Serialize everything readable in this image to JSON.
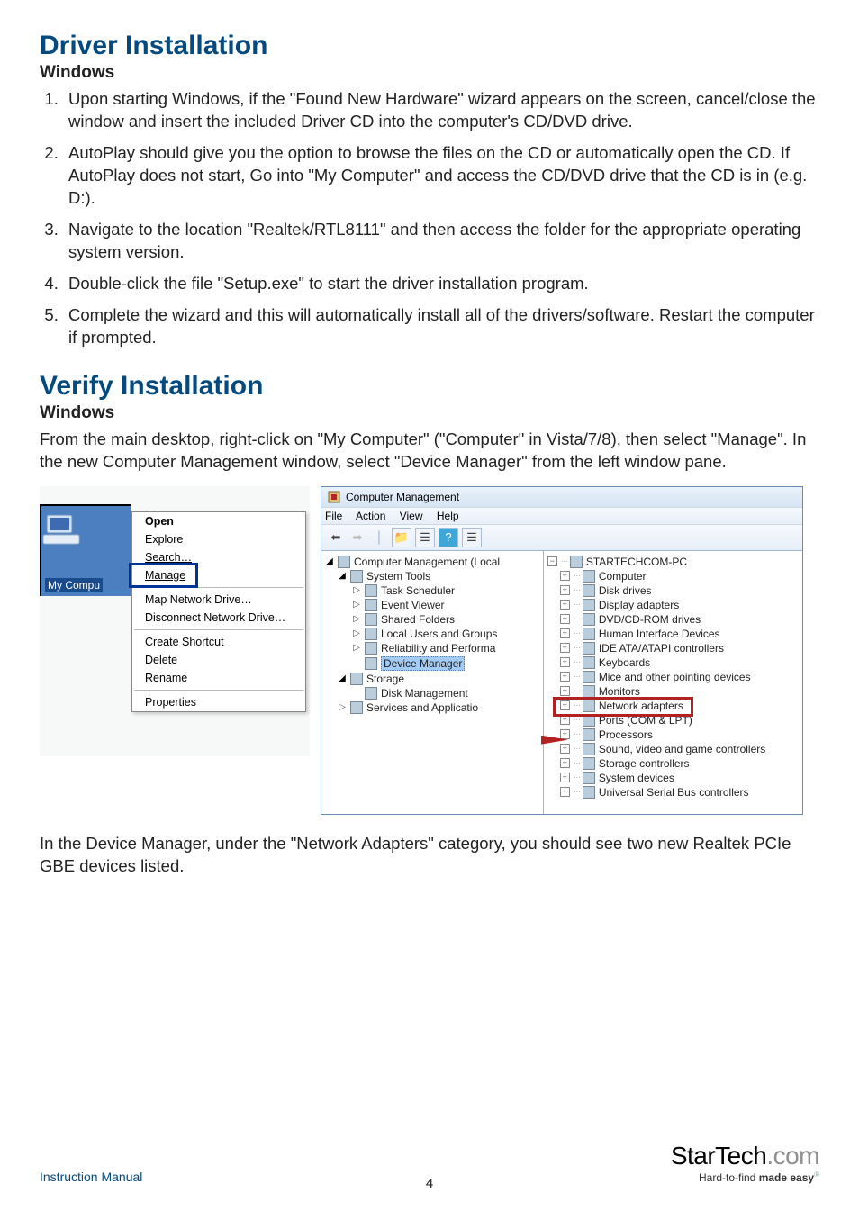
{
  "headings": {
    "h1a": "Driver Installation",
    "h2a": "Windows",
    "h1b": "Verify Installation",
    "h2b": "Windows"
  },
  "driver_steps": [
    "Upon starting Windows, if the \"Found New Hardware\" wizard appears on the screen, cancel/close the window and insert the included Driver CD into the computer's CD/DVD drive.",
    "AutoPlay should give you the option to browse the files on the CD or automatically open the CD.  If AutoPlay does not start, Go into \"My Computer\" and access the CD/DVD drive that the CD is in (e.g. D:).",
    "Navigate to the location \"Realtek/RTL8111\" and then access the folder for the appropriate operating system version.",
    "Double-click the file \"Setup.exe\" to start the driver installation program.",
    "Complete the wizard and this will automatically install all of the drivers/software.  Restart the computer if prompted."
  ],
  "verify_intro": "From the main desktop, right-click on \"My Computer\" (\"Computer\" in Vista/7/8), then select \"Manage\". In the new Computer Management window, select \"Device Manager\" from the left window pane.",
  "verify_outro": "In the Device Manager, under the \"Network Adapters\" category, you should see two new Realtek PCIe GBE devices listed.",
  "context_menu": {
    "desktop_label": "My Compu",
    "items_a": [
      "Open",
      "Explore",
      "Search…",
      "Manage"
    ],
    "items_b": [
      "Map Network Drive…",
      "Disconnect Network Drive…"
    ],
    "items_c": [
      "Create Shortcut",
      "Delete",
      "Rename"
    ],
    "items_d": [
      "Properties"
    ]
  },
  "cm_window": {
    "title": "Computer Management",
    "menus": [
      "File",
      "Action",
      "View",
      "Help"
    ],
    "left_pane": [
      {
        "text": "Computer Management (Local",
        "indent": 0,
        "exp": "open",
        "icon": "tool"
      },
      {
        "text": "System Tools",
        "indent": 1,
        "exp": "open",
        "icon": "tools"
      },
      {
        "text": "Task Scheduler",
        "indent": 2,
        "exp": "closed",
        "icon": "clock"
      },
      {
        "text": "Event Viewer",
        "indent": 2,
        "exp": "closed",
        "icon": "event"
      },
      {
        "text": "Shared Folders",
        "indent": 2,
        "exp": "closed",
        "icon": "share"
      },
      {
        "text": "Local Users and Groups",
        "indent": 2,
        "exp": "closed",
        "icon": "users"
      },
      {
        "text": "Reliability and Performa",
        "indent": 2,
        "exp": "closed",
        "icon": "perf"
      },
      {
        "text": "Device Manager",
        "indent": 2,
        "exp": "none",
        "icon": "devmgr",
        "selected": true
      },
      {
        "text": "Storage",
        "indent": 1,
        "exp": "open",
        "icon": "storage"
      },
      {
        "text": "Disk Management",
        "indent": 2,
        "exp": "none",
        "icon": "disk"
      },
      {
        "text": "Services and Applicatio",
        "indent": 1,
        "exp": "closed",
        "icon": "svc"
      }
    ],
    "right_pane": [
      {
        "text": "STARTECHCOM-PC",
        "exp": "minus",
        "icon": "pc"
      },
      {
        "text": "Computer",
        "exp": "plus",
        "icon": "computer"
      },
      {
        "text": "Disk drives",
        "exp": "plus",
        "icon": "disk"
      },
      {
        "text": "Display adapters",
        "exp": "plus",
        "icon": "display"
      },
      {
        "text": "DVD/CD-ROM drives",
        "exp": "plus",
        "icon": "dvd"
      },
      {
        "text": "Human Interface Devices",
        "exp": "plus",
        "icon": "hid"
      },
      {
        "text": "IDE ATA/ATAPI controllers",
        "exp": "plus",
        "icon": "ide"
      },
      {
        "text": "Keyboards",
        "exp": "plus",
        "icon": "kbd"
      },
      {
        "text": "Mice and other pointing devices",
        "exp": "plus",
        "icon": "mouse"
      },
      {
        "text": "Monitors",
        "exp": "plus",
        "icon": "monitor"
      },
      {
        "text": "Network adapters",
        "exp": "plus",
        "icon": "net",
        "highlight": true
      },
      {
        "text": "Ports (COM & LPT)",
        "exp": "plus",
        "icon": "port"
      },
      {
        "text": "Processors",
        "exp": "plus",
        "icon": "cpu"
      },
      {
        "text": "Sound, video and game controllers",
        "exp": "plus",
        "icon": "sound"
      },
      {
        "text": "Storage controllers",
        "exp": "plus",
        "icon": "stor"
      },
      {
        "text": "System devices",
        "exp": "plus",
        "icon": "sys"
      },
      {
        "text": "Universal Serial Bus controllers",
        "exp": "plus",
        "icon": "usb"
      }
    ]
  },
  "footer": {
    "left": "Instruction Manual",
    "page_num": "4",
    "brand_name_a": "StarTech",
    "brand_name_b": ".com",
    "tag_a": "Hard-to-find ",
    "tag_b": "made easy",
    "tag_sup": "®"
  }
}
